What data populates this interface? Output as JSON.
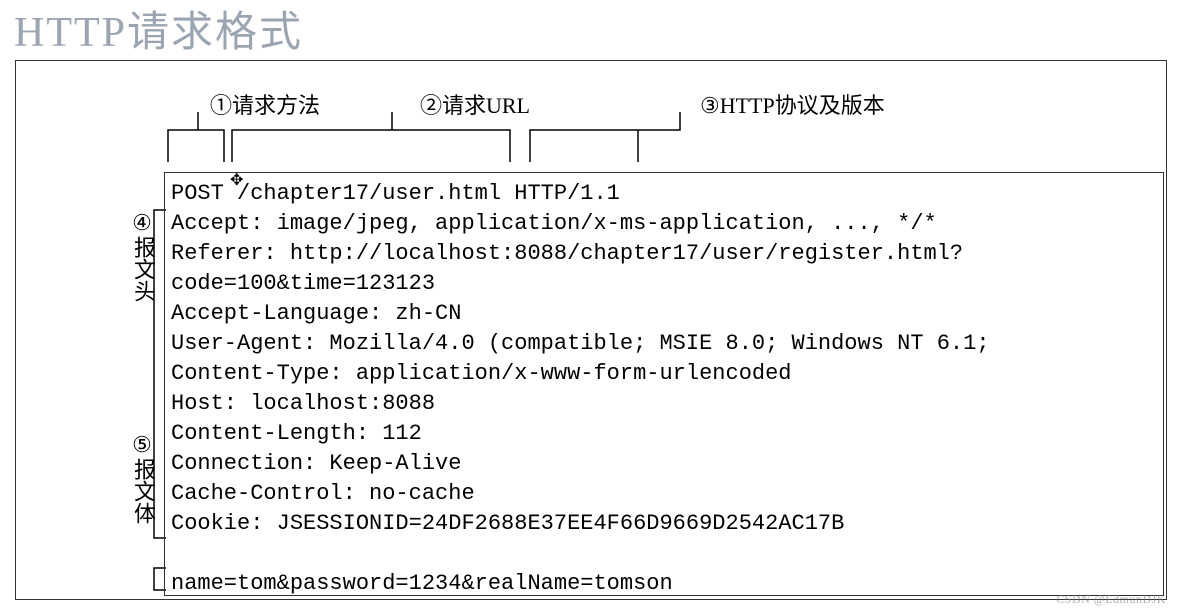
{
  "title": "HTTP请求格式",
  "labels": {
    "method": "①请求方法",
    "url": "②请求URL",
    "protocol": "③HTTP协议及版本",
    "header_num": "④",
    "header_text": "报文头",
    "body_num": "⑤",
    "body_text": "报文体"
  },
  "request": {
    "line": "POST /chapter17/user.html HTTP/1.1",
    "headers": [
      "Accept: image/jpeg, application/x-ms-application, ..., */*",
      "Referer: http://localhost:8088/chapter17/user/register.html?",
      "code=100&time=123123",
      "Accept-Language: zh-CN",
      "User-Agent: Mozilla/4.0 (compatible; MSIE 8.0; Windows NT 6.1;",
      "Content-Type: application/x-www-form-urlencoded",
      "Host: localhost:8088",
      "Content-Length: 112",
      "Connection: Keep-Alive",
      "Cache-Control: no-cache",
      "Cookie: JSESSIONID=24DF2688E37EE4F66D9669D2542AC17B"
    ],
    "body": "name=tom&password=1234&realName=tomson"
  },
  "watermark1": "CSDN @EdmunDJK",
  "watermark2": ""
}
